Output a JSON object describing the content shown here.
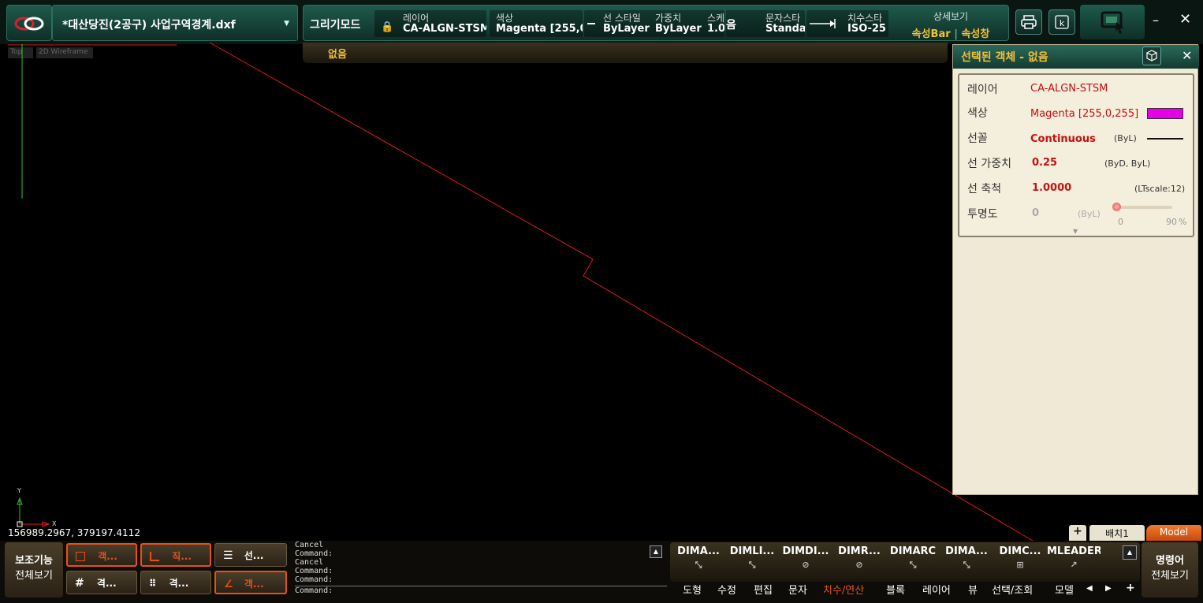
{
  "file": {
    "title": "*대산당진(2공구) 사업구역경계.dxf"
  },
  "toolbar": {
    "draw_mode": "그리기모드",
    "layer_label": "레이어",
    "layer_value": "CA-ALGN-STSM",
    "color_label": "색상",
    "color_value": "Magenta [255,0,",
    "linestyle_label": "선 스타일",
    "linestyle_value": "ByLayer",
    "weight_label": "가중치",
    "weight_value": "ByLayer",
    "scale_label": "스케",
    "scale_value": "1.0",
    "extra_label": "음",
    "textstyle_label": "문자스타",
    "textstyle_value": "Standar",
    "dimstyle_label": "치수스타",
    "dimstyle_value": "ISO-25",
    "detail_label": "상세보기",
    "detail_bar": "속성Bar",
    "detail_window": "속성창",
    "sub_value": "없음"
  },
  "viewport": {
    "view_top": "Top",
    "view_wire": "2D Wireframe",
    "coords": "156989.2967, 379197.4112",
    "axis_x": "X",
    "axis_y": "Y"
  },
  "panel": {
    "title": "선택된 객체 - 없음",
    "layer_label": "레이어",
    "layer_value": "CA-ALGN-STSM",
    "color_label": "색상",
    "color_value": "Magenta [255,0,255]",
    "swatch": "#e600e6",
    "linetype_label": "선꼴",
    "linetype_value": "Continuous",
    "linetype_note": "(ByL)",
    "weight_label": "선 가중치",
    "weight_value": "0.25",
    "weight_note": "(ByD, ByL)",
    "scale_label": "선 축척",
    "scale_value": "1.0000",
    "scale_note": "(LTscale:12)",
    "trans_label": "투명도",
    "trans_value": "0",
    "trans_note": "(ByL)",
    "trans_min": "0",
    "trans_max": "90",
    "trans_unit": "%"
  },
  "bottom": {
    "aux": "보조기능",
    "fullview": "전체보기",
    "btn1": "객...",
    "btn2": "직...",
    "btn3": "선...",
    "btn4": "격...",
    "btn5": "격...",
    "btn6": "객...",
    "cmd_lines": [
      "Cancel",
      "Command:",
      "Cancel",
      "Command:",
      "Command:",
      "Command:"
    ],
    "cmd_word": "명령어",
    "cmd_full": "전체보기"
  },
  "dims": {
    "b1": "DIMA...",
    "b2": "DIMLI...",
    "b3": "DIMDI...",
    "b4": "DIMR...",
    "b5": "DIMARC",
    "b6": "DIMA...",
    "b7": "DIMC...",
    "b8": "MLEADER"
  },
  "menus": {
    "m1": "도형",
    "m2": "수정",
    "m3": "편집",
    "m4": "문자",
    "m5": "치수/연산",
    "m6": "블록",
    "m7": "레이어",
    "m8": "뷰",
    "m9": "선택/조회",
    "m10": "모델"
  },
  "layout_tabs": {
    "plus": "+",
    "layout1": "배치1",
    "model": "Model"
  },
  "colors": {
    "accent": "#e8501a",
    "gold": "#f2c13a",
    "line": "#e21b1b"
  }
}
